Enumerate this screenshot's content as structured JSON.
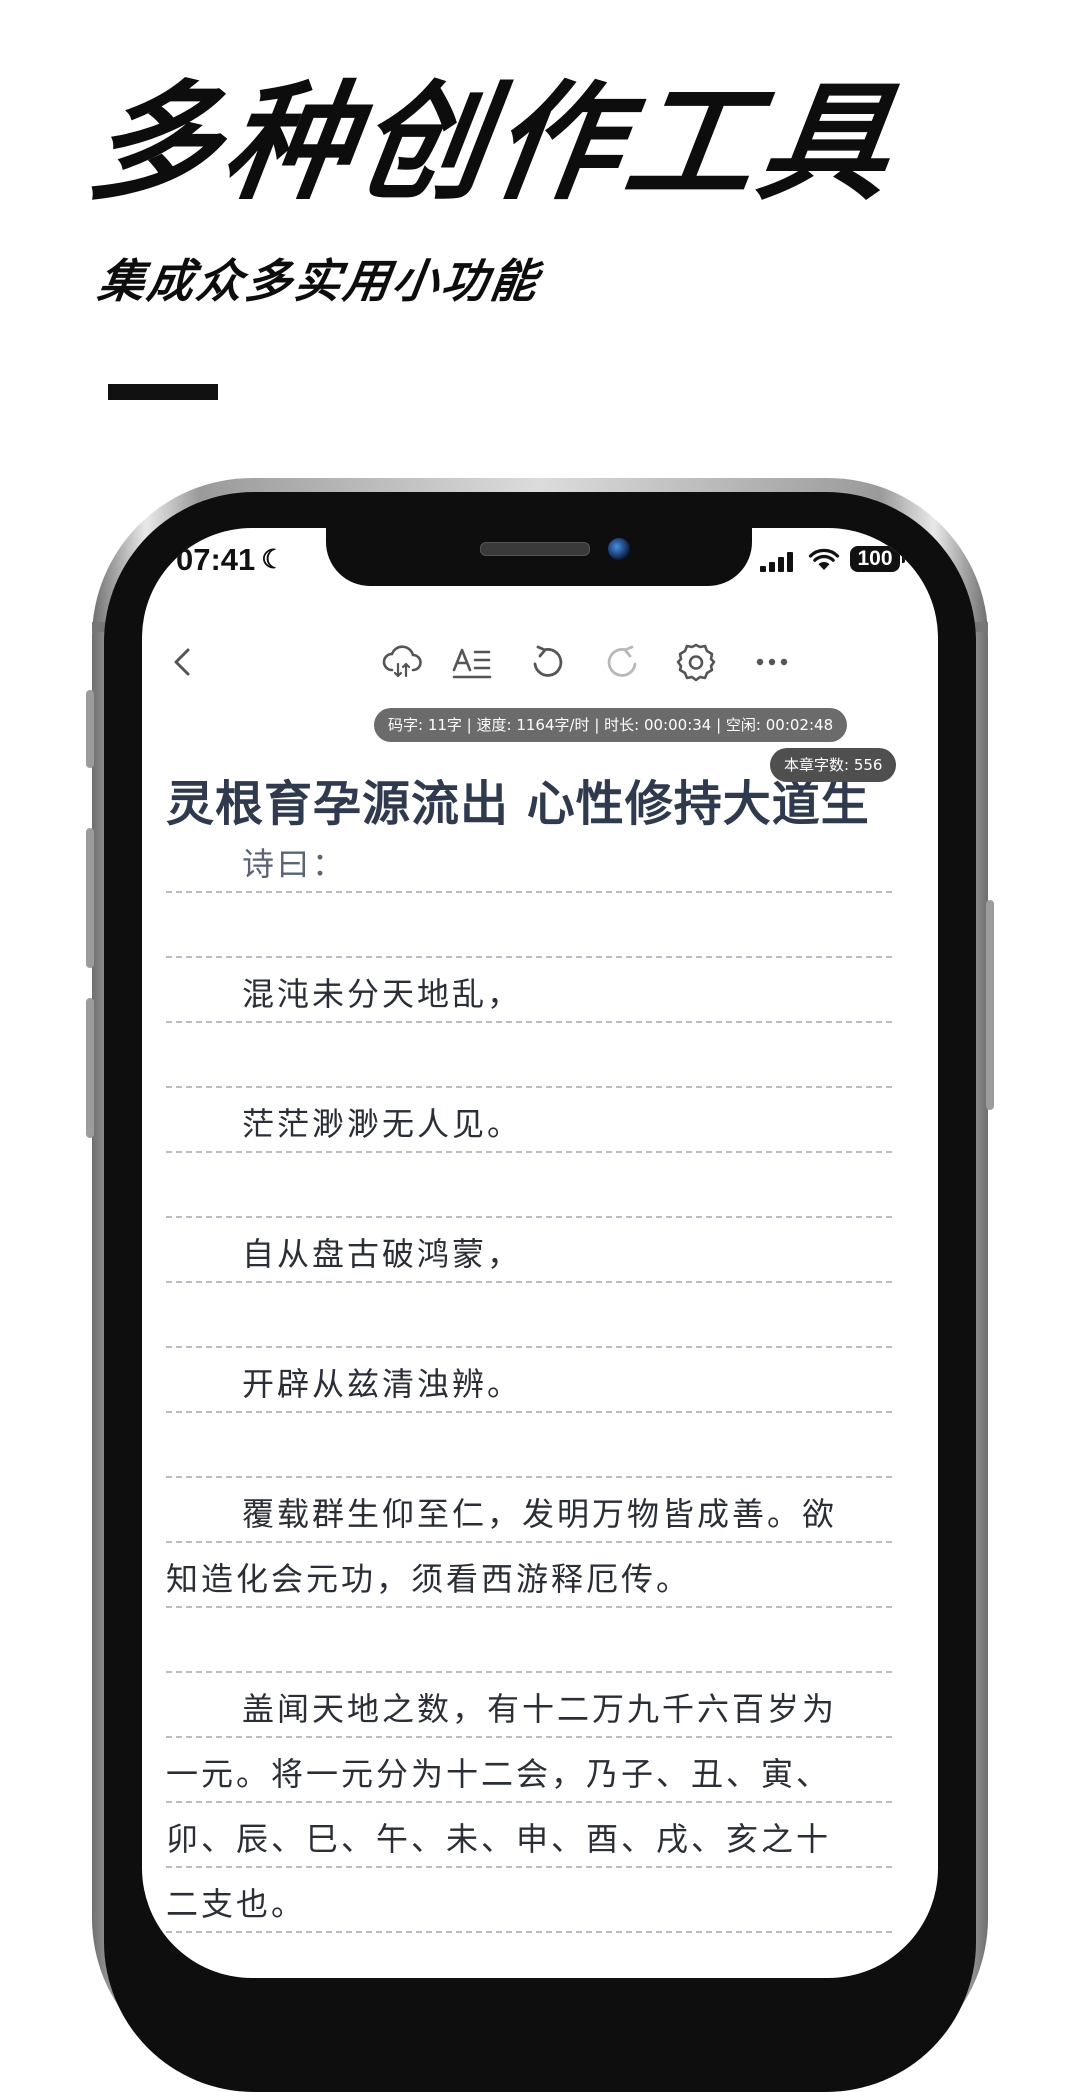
{
  "promo": {
    "title": "多种创作工具",
    "subtitle": "集成众多实用小功能"
  },
  "status_bar": {
    "time": "07:41",
    "battery": "100"
  },
  "toolbar": {
    "icons": [
      "back-icon",
      "cloud-sync-icon",
      "font-format-icon",
      "undo-icon",
      "redo-icon",
      "settings-icon",
      "more-icon"
    ]
  },
  "stats": {
    "bar": "码字: 11字 | 速度: 1164字/时 | 时长: 00:00:34 | 空闲: 00:02:48",
    "chapter_count": "本章字数: 556"
  },
  "chapter": {
    "title": "灵根育孕源流出 心性修持大道生"
  },
  "editor": {
    "lines": [
      "诗曰：",
      "",
      "混沌未分天地乱，",
      "",
      "茫茫渺渺无人见。",
      "",
      "自从盘古破鸿蒙，",
      "",
      "开辟从兹清浊辨。",
      "",
      "覆载群生仰至仁，发明万物皆成善。欲",
      "知造化会元功，须看西游释厄传。",
      "",
      "盖闻天地之数，有十二万九千六百岁为",
      "一元。将一元分为十二会，乃子、丑、寅、",
      "卯、辰、巳、午、未、申、酉、戌、亥之十",
      "二支也。"
    ]
  },
  "colors": {
    "title_text": "#2f3a4e",
    "body_text": "#2a2e36",
    "pill_bg": "#6b6b6b",
    "guide_line": "#b9bcc4"
  }
}
